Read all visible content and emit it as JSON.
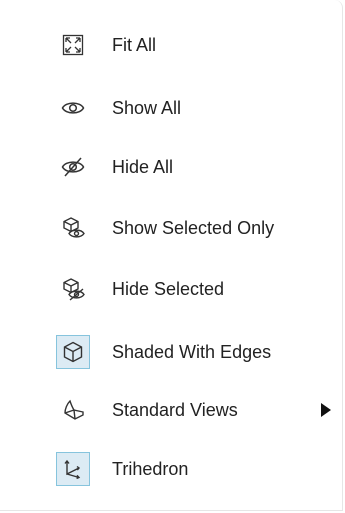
{
  "menu": {
    "items": [
      {
        "label": "Fit All",
        "icon": "fit-all-icon",
        "checked": false
      },
      {
        "label": "Show All",
        "icon": "eye-icon",
        "checked": false
      },
      {
        "label": "Hide All",
        "icon": "eye-off-icon",
        "checked": false
      },
      {
        "label": "Show Selected Only",
        "icon": "show-selected-icon",
        "checked": false
      },
      {
        "label": "Hide Selected",
        "icon": "hide-selected-icon",
        "checked": false
      },
      {
        "label": "Shaded With Edges",
        "icon": "cube-icon",
        "checked": true
      },
      {
        "label": "Standard Views",
        "icon": "standard-views-icon",
        "checked": false,
        "has_submenu": true
      },
      {
        "label": "Trihedron",
        "icon": "trihedron-icon",
        "checked": true
      }
    ]
  },
  "colors": {
    "checked_background": "#dcebf4",
    "checked_border": "#86c4dd",
    "text": "#222222"
  }
}
